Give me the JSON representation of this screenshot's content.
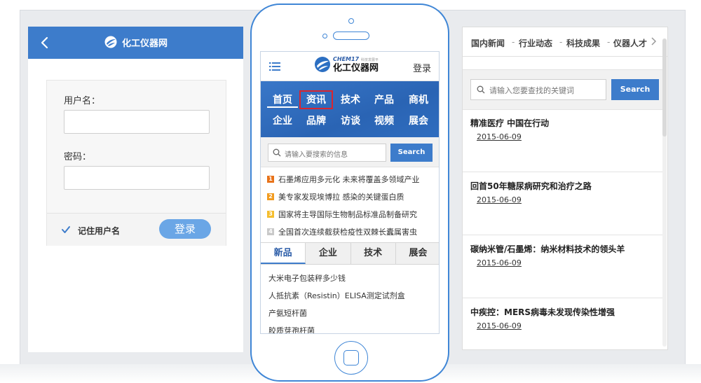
{
  "login": {
    "brand": "化工仪器网",
    "username_label": "用户名：",
    "username_value": "",
    "password_label": "密码：",
    "password_value": "",
    "remember_label": "记住用户名",
    "remember_checked": true,
    "submit_label": "登录"
  },
  "mobile": {
    "logo_en": "CHEM17",
    "logo_tagline": "科技发展平",
    "logo_cn": "化工仪器网",
    "login_link": "登录",
    "nav": [
      {
        "label": "首页",
        "active": true
      },
      {
        "label": "资讯",
        "highlighted": true
      },
      {
        "label": "技术"
      },
      {
        "label": "产品"
      },
      {
        "label": "商机"
      },
      {
        "label": "企业"
      },
      {
        "label": "品牌"
      },
      {
        "label": "访谈"
      },
      {
        "label": "视频"
      },
      {
        "label": "展会"
      }
    ],
    "search_placeholder": "请输入要搜索的信息",
    "search_button": "Search",
    "hot_list": [
      {
        "rank": "1",
        "text": "石墨烯应用多元化 未来将覆盖多领域产业",
        "color": "#e8731a"
      },
      {
        "rank": "2",
        "text": "美专家发现埃博拉 感染的关键蛋白质",
        "color": "#f29b1f"
      },
      {
        "rank": "3",
        "text": "国家将主导国际生物制品标准品制备研究",
        "color": "#f5be2e"
      },
      {
        "rank": "4",
        "text": "全国首次连续截获检疫性双棘长蠹属害虫",
        "color": "#c9c9c9"
      }
    ],
    "tabs": [
      {
        "label": "新品",
        "active": true
      },
      {
        "label": "企业"
      },
      {
        "label": "技术"
      },
      {
        "label": "展会"
      }
    ],
    "products": [
      "大米电子包装秤多少钱",
      "人抵抗素（Resistin）ELISA测定试剂盒",
      "产氨短杆菌",
      "胶质芽孢杆菌"
    ]
  },
  "news_panel": {
    "tabs": [
      "国内新闻",
      "行业动态",
      "科技成果",
      "仪器人才"
    ],
    "separator": "-",
    "search_placeholder": "请输入您要查找的关键词",
    "search_button": "Search",
    "articles": [
      {
        "title": "精准医疗 中国在行动",
        "date": "2015-06-09"
      },
      {
        "title": "回首50年糖尿病研究和治疗之路",
        "date": "2015-06-09"
      },
      {
        "title": "碳纳米管/石墨烯：纳米材料技术的领头羊",
        "date": "2015-06-09"
      },
      {
        "title": "中疾控：MERS病毒未发现传染性增强",
        "date": "2015-06-09"
      }
    ]
  },
  "colors": {
    "brand_blue": "#3d7ccb",
    "nav_blue": "#2f6dbf",
    "highlight_red": "#d9252f",
    "phone_outline": "#3f86d6",
    "login_button": "#6aa6e6"
  }
}
